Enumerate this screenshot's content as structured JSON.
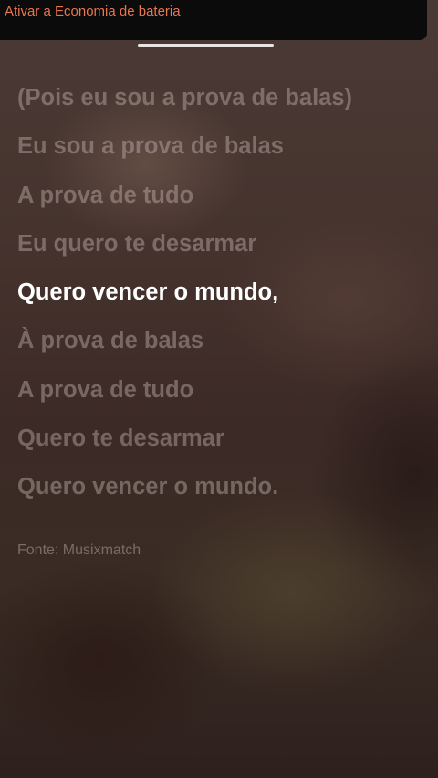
{
  "notification": {
    "text": "Ativar a Economia de bateria"
  },
  "lyrics": {
    "lines": [
      "(Pois eu sou a prova de balas)",
      "Eu sou a prova de balas",
      "A prova de tudo",
      "Eu quero te desarmar",
      "Quero vencer o mundo,",
      "À prova de balas",
      "A prova de tudo",
      "Quero te desarmar",
      "Quero vencer o mundo."
    ],
    "active_line": 5,
    "source": "Fonte: Musixmatch"
  },
  "colors": {
    "notification_text": "#e8764f",
    "active_line": "#ffffff"
  }
}
